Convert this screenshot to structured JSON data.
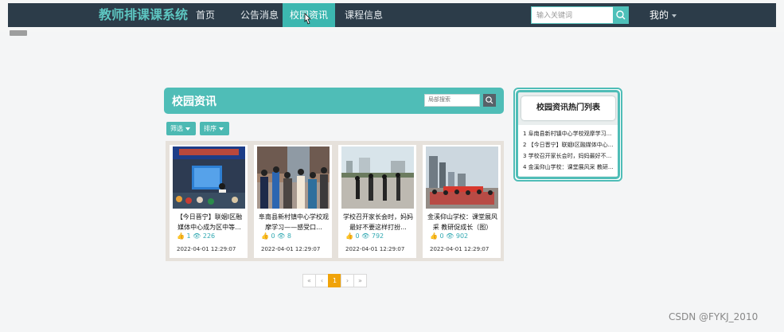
{
  "nav": {
    "brand": "教师排课课系统",
    "items": [
      {
        "label": "首页"
      },
      {
        "label": "公告消息"
      },
      {
        "label": "校园资讯",
        "active": true
      },
      {
        "label": "课程信息"
      }
    ],
    "search_placeholder": "输入关键词",
    "search_icon": "search-icon",
    "user_label": "我的"
  },
  "page": {
    "section_title": "校园资讯",
    "local_search_placeholder": "局部搜索",
    "filter_label": "筛选",
    "sort_label": "排序"
  },
  "news": [
    {
      "title": "【今日晋宁】联姻I区融媒体中心成为区中等...",
      "likes": "1",
      "views": "226",
      "date": "2022-04-01 12:29:07"
    },
    {
      "title": "阜南县新村镇中心学校观摩学习——感受口...",
      "likes": "0",
      "views": "8",
      "date": "2022-04-01 12:29:07"
    },
    {
      "title": "学校召开家长会时，妈妈最好不要这样打扮...",
      "likes": "0",
      "views": "792",
      "date": "2022-04-01 12:29:07"
    },
    {
      "title": "金溪仰山学校：课堂展风采 教研促成长（图）",
      "likes": "0",
      "views": "902",
      "date": "2022-04-01 12:29:07"
    }
  ],
  "pagination": {
    "first": "«",
    "prev": "‹",
    "current": "1",
    "next": "›",
    "last": "»"
  },
  "hot": {
    "title": "校园资讯热门列表",
    "items": [
      "1 阜南县新村镇中心学校观摩学习...",
      "2 【今日晋宁】联姻I区融媒体中心...",
      "3 学校召开家长会时，妈妈最好不...",
      "4 金溪仰山学校：课堂展风采 教研..."
    ]
  },
  "watermark": "CSDN @FYKJ_2010",
  "colors": {
    "nav_bg": "#2c3c49",
    "accent": "#4fbdb7",
    "pager_active": "#f0a30a"
  }
}
